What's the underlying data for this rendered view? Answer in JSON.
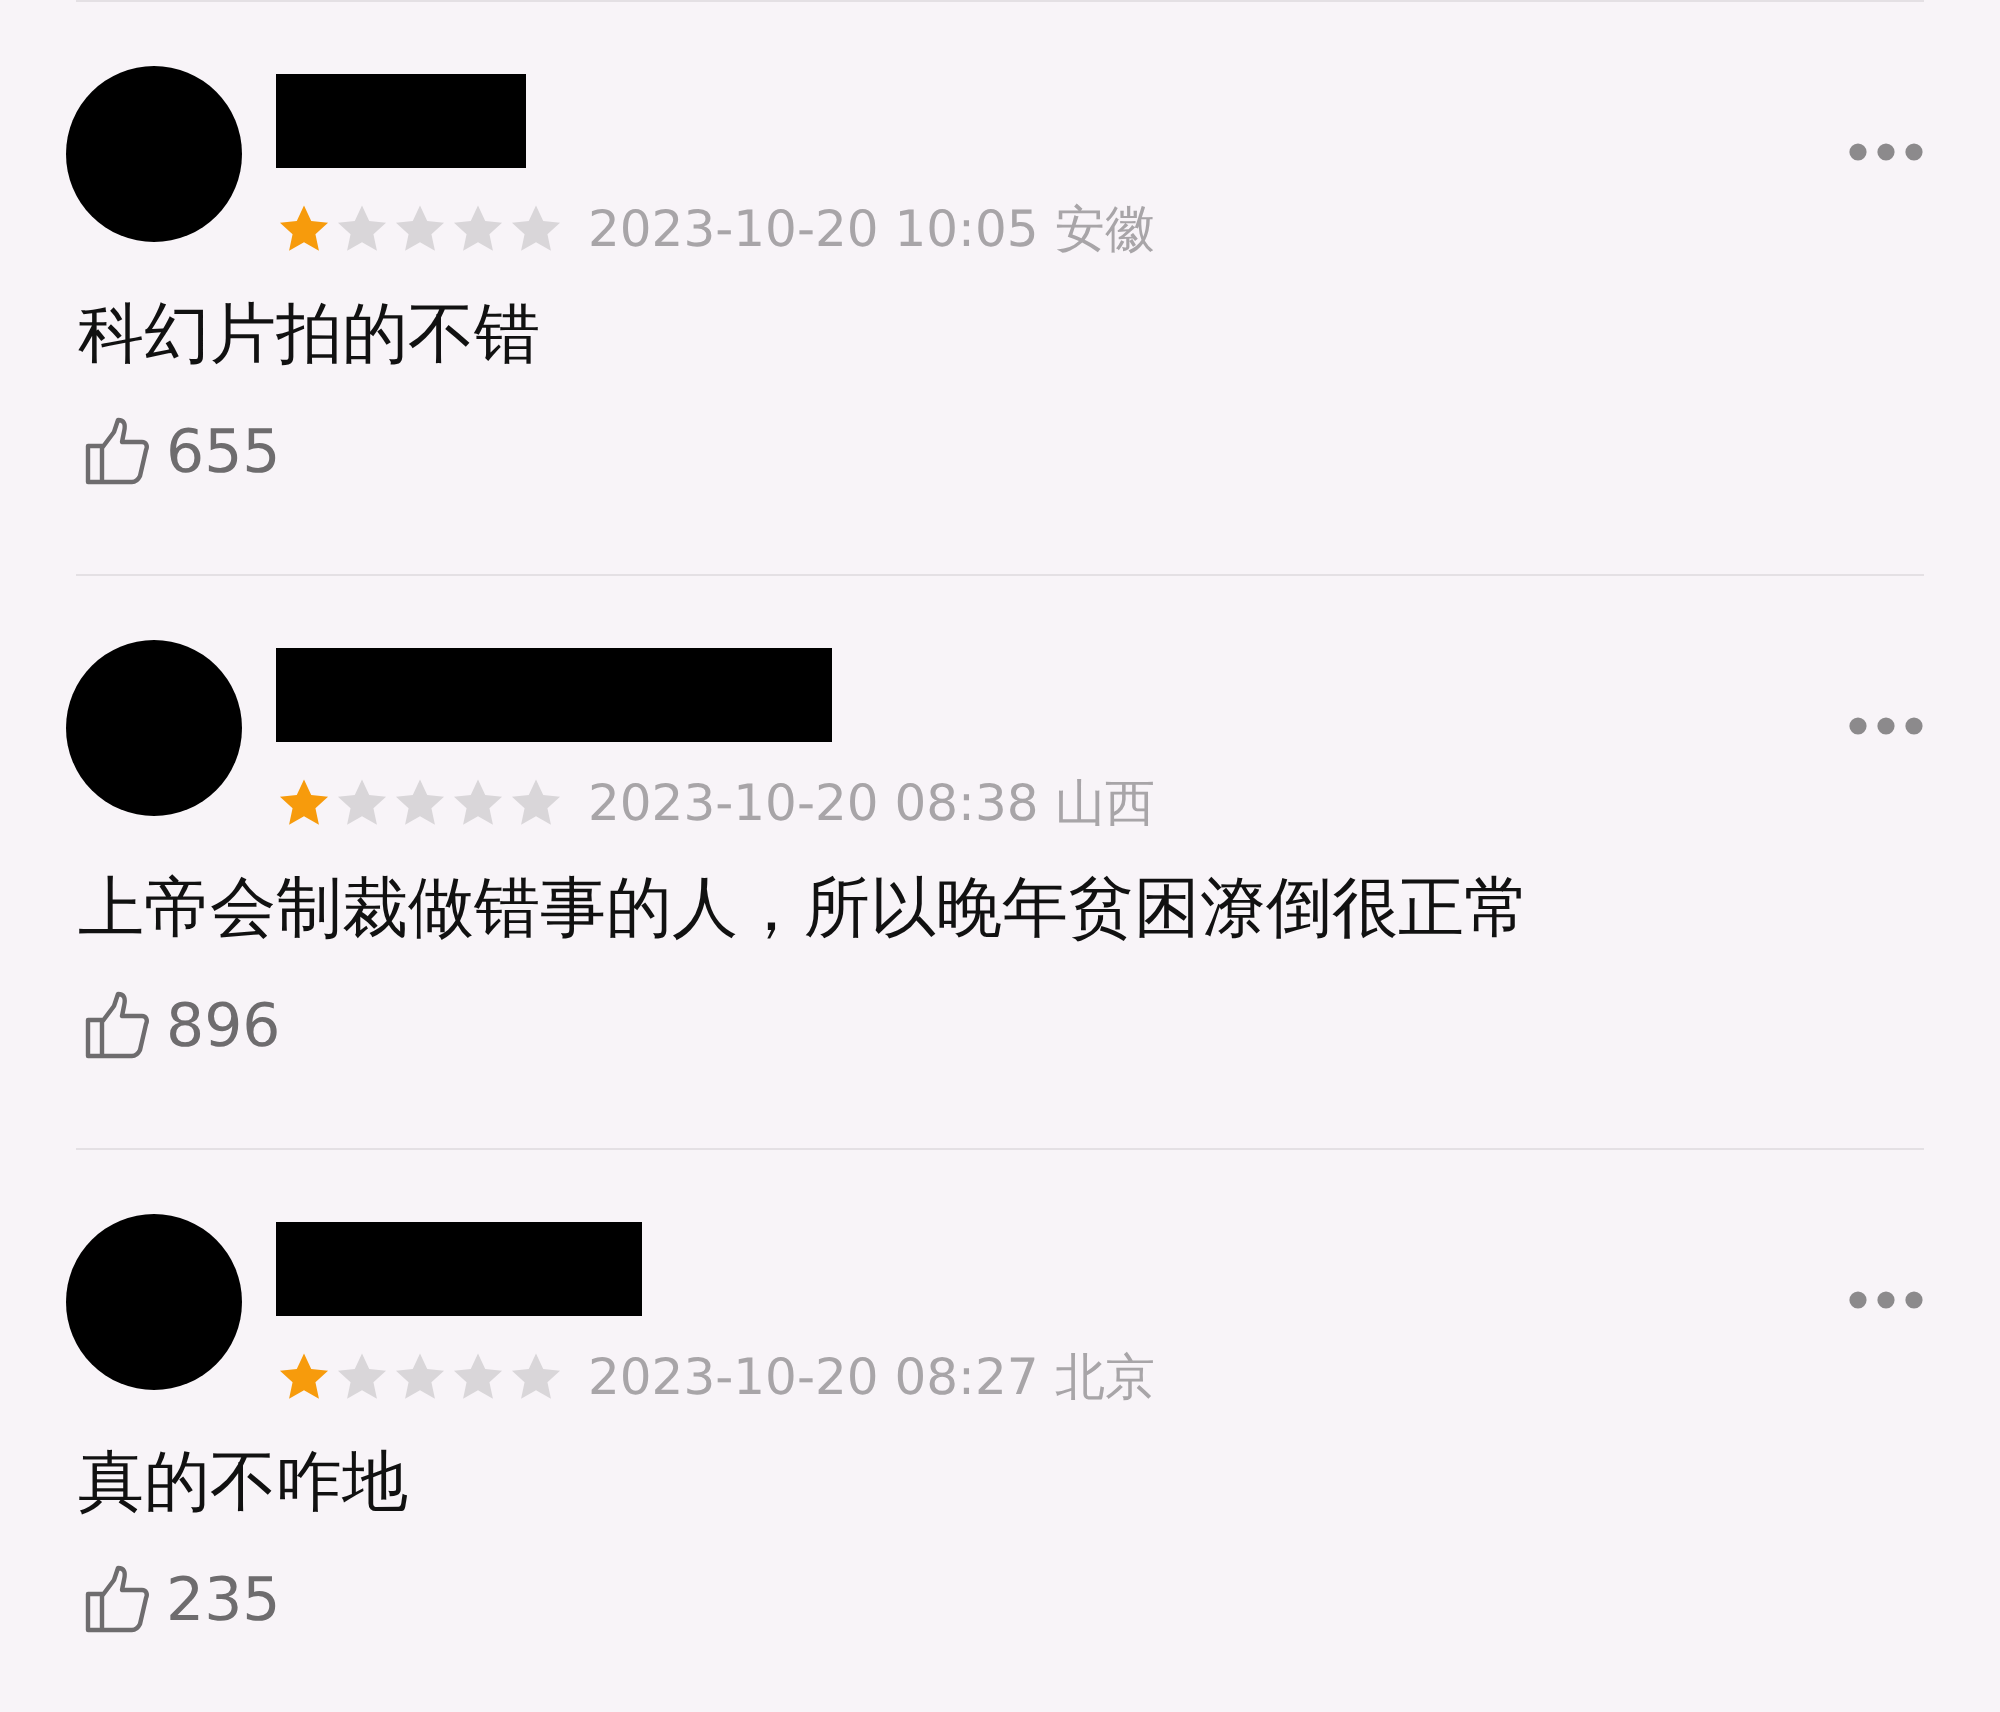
{
  "reviews": [
    {
      "stars": 1,
      "time": "2023-10-20 10:05",
      "region": "安徽",
      "comment": "科幻片拍的不错",
      "likes": "655"
    },
    {
      "stars": 1,
      "time": "2023-10-20 08:38",
      "region": "山西",
      "comment": "上帝会制裁做错事的人，所以晚年贫困潦倒很正常",
      "likes": "896"
    },
    {
      "stars": 1,
      "time": "2023-10-20 08:27",
      "region": "北京",
      "comment": "真的不咋地",
      "likes": "235"
    }
  ]
}
